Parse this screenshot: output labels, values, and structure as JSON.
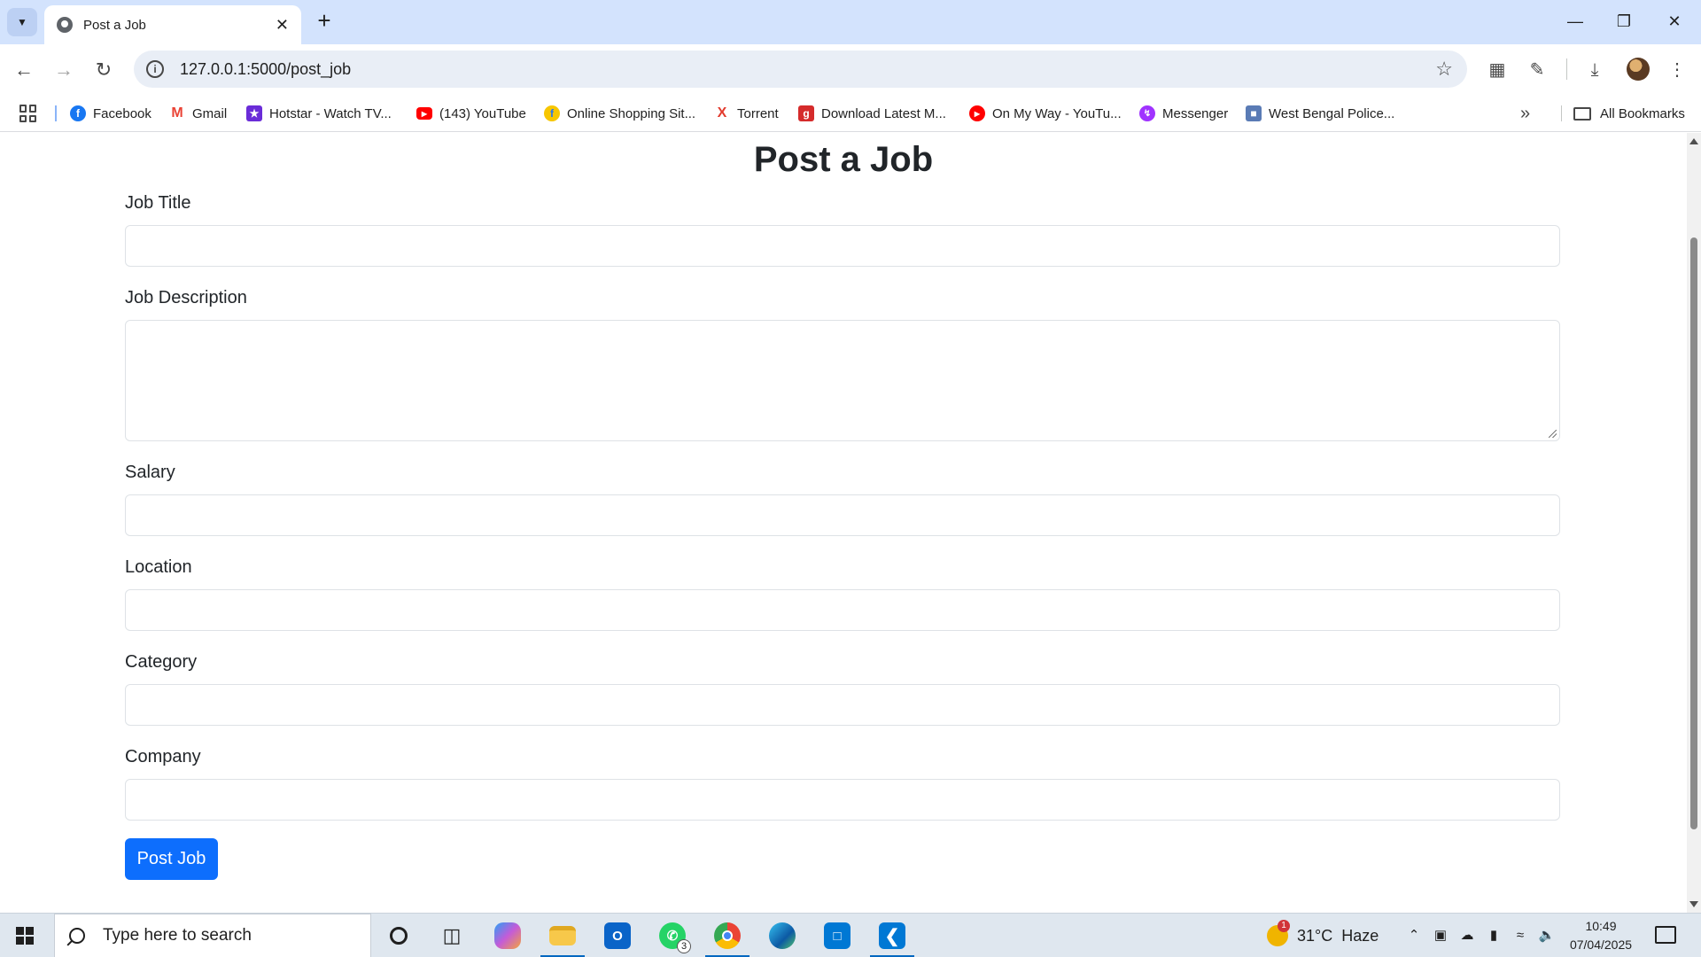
{
  "browser": {
    "tab_title": "Post a Job",
    "url": "127.0.0.1:5000/post_job",
    "bookmarks": [
      {
        "label": "Facebook",
        "icon": "facebook-icon",
        "color": "#1877f2"
      },
      {
        "label": "Gmail",
        "icon": "gmail-icon",
        "color": "#ea4335"
      },
      {
        "label": "Hotstar - Watch TV...",
        "icon": "hotstar-icon",
        "color": "#6a2cd8"
      },
      {
        "label": "(143) YouTube",
        "icon": "youtube-icon",
        "color": "#ff0000"
      },
      {
        "label": "Online Shopping Sit...",
        "icon": "flipkart-icon",
        "color": "#f7c600"
      },
      {
        "label": "Torrent",
        "icon": "torrent-icon",
        "color": "#e23b2e"
      },
      {
        "label": "Download Latest M...",
        "icon": "download-site-icon",
        "color": "#d52b2b"
      },
      {
        "label": "On My Way - YouTu...",
        "icon": "youtube-music-icon",
        "color": "#ff0000"
      },
      {
        "label": "Messenger",
        "icon": "messenger-icon",
        "color": "#a033ff"
      },
      {
        "label": "West Bengal Police...",
        "icon": "police-site-icon",
        "color": "#5a7bb5"
      }
    ],
    "all_bookmarks_label": "All Bookmarks"
  },
  "page": {
    "title": "Post a Job",
    "fields": [
      {
        "label": "Job Title",
        "type": "input",
        "value": ""
      },
      {
        "label": "Job Description",
        "type": "textarea",
        "value": ""
      },
      {
        "label": "Salary",
        "type": "input",
        "value": ""
      },
      {
        "label": "Location",
        "type": "input",
        "value": ""
      },
      {
        "label": "Category",
        "type": "input",
        "value": ""
      },
      {
        "label": "Company",
        "type": "input",
        "value": ""
      }
    ],
    "submit_label": "Post Job",
    "submit_color": "#0d6efd"
  },
  "taskbar": {
    "search_placeholder": "Type here to search",
    "weather_temp": "31°C",
    "weather_desc": "Haze",
    "weather_badge": "1",
    "whatsapp_badge": "3",
    "time": "10:49",
    "date": "07/04/2025"
  }
}
